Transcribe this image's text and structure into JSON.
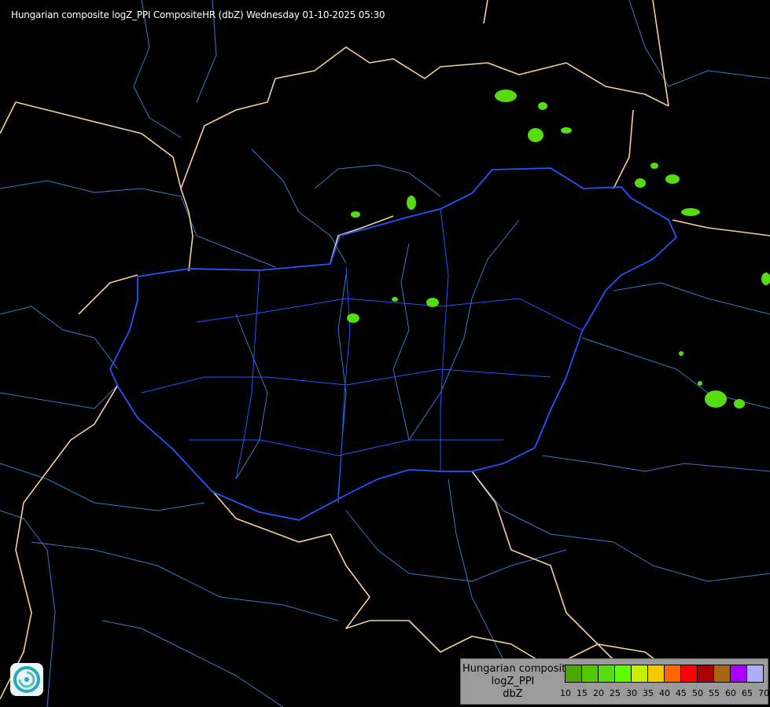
{
  "title": "Hungarian composite logZ_PPI CompositeHR (dbZ) Wednesday 01-10-2025 05:30",
  "legend": {
    "lines": [
      "Hungarian composite",
      "logZ_PPI",
      "dbZ"
    ],
    "ticks": [
      "10",
      "15",
      "20",
      "25",
      "30",
      "35",
      "40",
      "45",
      "50",
      "55",
      "60",
      "65",
      "70"
    ],
    "colors": [
      "#4ea600",
      "#52c800",
      "#55dd11",
      "#5cff00",
      "#c8ee00",
      "#f5c800",
      "#ff6600",
      "#ff0000",
      "#aa0000",
      "#a86410",
      "#aa00ff",
      "#aab0ff"
    ]
  },
  "map_colors": {
    "background": "#000000",
    "hungary_border": "#2255ff",
    "country_border": "#f3d19c",
    "rivers": "#3b78c8",
    "echo": "#55dd11"
  },
  "logo": "radar-service-logo"
}
